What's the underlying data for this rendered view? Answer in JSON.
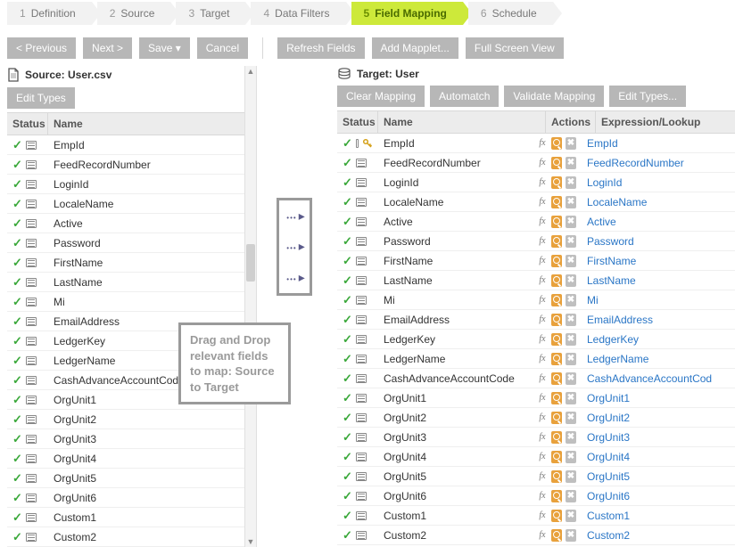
{
  "wizard": {
    "steps": [
      {
        "num": "1",
        "label": "Definition"
      },
      {
        "num": "2",
        "label": "Source"
      },
      {
        "num": "3",
        "label": "Target"
      },
      {
        "num": "4",
        "label": "Data Filters"
      },
      {
        "num": "5",
        "label": "Field Mapping"
      },
      {
        "num": "6",
        "label": "Schedule"
      }
    ],
    "activeIndex": 4
  },
  "actions": {
    "previous": "< Previous",
    "next": "Next >",
    "save": "Save",
    "cancel": "Cancel",
    "refresh_fields": "Refresh Fields",
    "add_mapplet": "Add Mapplet...",
    "full_screen": "Full Screen View"
  },
  "source": {
    "title": "Source: User.csv",
    "toolbar": {
      "edit_types": "Edit Types"
    },
    "columns": {
      "status": "Status",
      "name": "Name"
    },
    "fields": [
      {
        "name": "EmpId"
      },
      {
        "name": "FeedRecordNumber"
      },
      {
        "name": "LoginId"
      },
      {
        "name": "LocaleName"
      },
      {
        "name": "Active"
      },
      {
        "name": "Password"
      },
      {
        "name": "FirstName"
      },
      {
        "name": "LastName"
      },
      {
        "name": "Mi"
      },
      {
        "name": "EmailAddress"
      },
      {
        "name": "LedgerKey"
      },
      {
        "name": "LedgerName"
      },
      {
        "name": "CashAdvanceAccountCode"
      },
      {
        "name": "OrgUnit1"
      },
      {
        "name": "OrgUnit2"
      },
      {
        "name": "OrgUnit3"
      },
      {
        "name": "OrgUnit4"
      },
      {
        "name": "OrgUnit5"
      },
      {
        "name": "OrgUnit6"
      },
      {
        "name": "Custom1"
      },
      {
        "name": "Custom2"
      }
    ]
  },
  "target": {
    "title": "Target: User",
    "toolbar": {
      "clear_mapping": "Clear Mapping",
      "automatch": "Automatch",
      "validate_mapping": "Validate Mapping",
      "edit_types": "Edit Types..."
    },
    "columns": {
      "status": "Status",
      "name": "Name",
      "actions": "Actions",
      "expression": "Expression/Lookup"
    },
    "fields": [
      {
        "name": "EmpId",
        "expr": "EmpId",
        "key": true
      },
      {
        "name": "FeedRecordNumber",
        "expr": "FeedRecordNumber"
      },
      {
        "name": "LoginId",
        "expr": "LoginId"
      },
      {
        "name": "LocaleName",
        "expr": "LocaleName"
      },
      {
        "name": "Active",
        "expr": "Active"
      },
      {
        "name": "Password",
        "expr": "Password"
      },
      {
        "name": "FirstName",
        "expr": "FirstName"
      },
      {
        "name": "LastName",
        "expr": "LastName"
      },
      {
        "name": "Mi",
        "expr": "Mi"
      },
      {
        "name": "EmailAddress",
        "expr": "EmailAddress"
      },
      {
        "name": "LedgerKey",
        "expr": "LedgerKey"
      },
      {
        "name": "LedgerName",
        "expr": "LedgerName"
      },
      {
        "name": "CashAdvanceAccountCode",
        "expr": "CashAdvanceAccountCod"
      },
      {
        "name": "OrgUnit1",
        "expr": "OrgUnit1"
      },
      {
        "name": "OrgUnit2",
        "expr": "OrgUnit2"
      },
      {
        "name": "OrgUnit3",
        "expr": "OrgUnit3"
      },
      {
        "name": "OrgUnit4",
        "expr": "OrgUnit4"
      },
      {
        "name": "OrgUnit5",
        "expr": "OrgUnit5"
      },
      {
        "name": "OrgUnit6",
        "expr": "OrgUnit6"
      },
      {
        "name": "Custom1",
        "expr": "Custom1"
      },
      {
        "name": "Custom2",
        "expr": "Custom2"
      }
    ]
  },
  "hints": {
    "drag_drop": "Drag and Drop relevant fields to map: Source to Target"
  },
  "icons": {
    "check": "check-icon",
    "field": "field-icon",
    "key": "key-icon",
    "fx": "fx-icon",
    "lookup": "lookup-icon",
    "clear": "clear-icon",
    "document": "document-icon",
    "database": "database-icon",
    "map_arrow": "map-arrow-icon"
  },
  "colors": {
    "wizard_active_bg": "#cde93a",
    "wizard_bg": "#f2f2f2",
    "button_bg": "#b7b7b7",
    "link": "#2a76c6",
    "check": "#3aa83a"
  }
}
